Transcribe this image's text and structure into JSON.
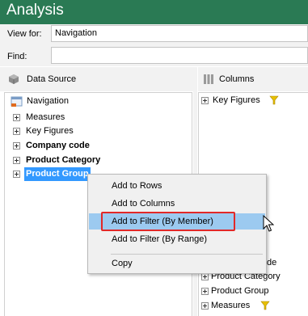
{
  "app": {
    "title": "Analysis"
  },
  "view_for": {
    "label": "View for:",
    "value": "Navigation"
  },
  "find": {
    "label": "Find:",
    "value": ""
  },
  "data_source": {
    "header": "Data Source",
    "root": "Navigation",
    "items": [
      "Measures",
      "Key Figures",
      "Company code",
      "Product Category",
      "Product Group"
    ]
  },
  "columns": {
    "header": "Columns",
    "items": [
      "Key Figures"
    ]
  },
  "rows": {
    "items": [
      "de",
      "Product Category",
      "Product Group",
      "Measures"
    ]
  },
  "context_menu": {
    "items": [
      "Add to Rows",
      "Add to Columns",
      "Add to Filter (By Member)",
      "Add to Filter (By Range)",
      "Copy"
    ],
    "highlighted_index": 2
  },
  "colors": {
    "title_bar": "#2a7a54",
    "selection": "#3399ff",
    "menu_highlight": "#9ccaf0",
    "callout": "#e22828",
    "filter_icon": "#e8c000"
  }
}
